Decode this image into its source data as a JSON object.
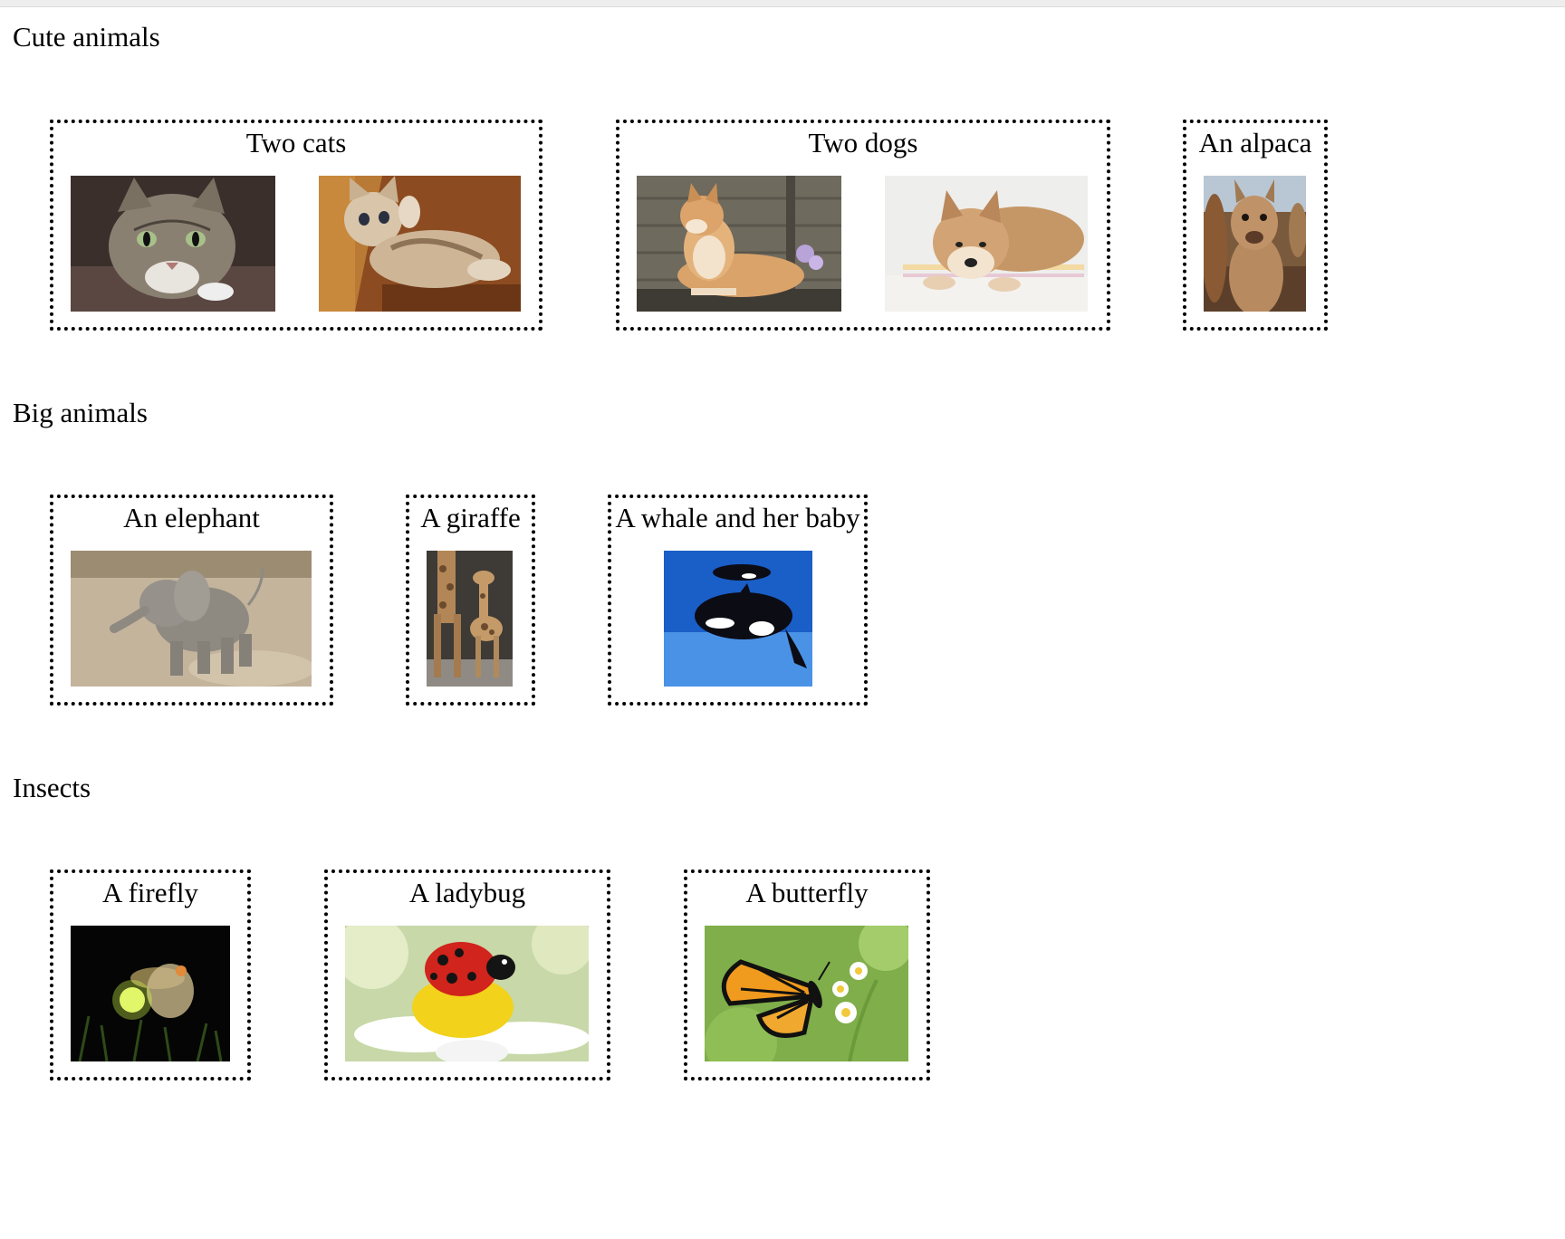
{
  "sections": [
    {
      "title": "Cute animals",
      "figures": [
        {
          "caption": "Two cats",
          "images": [
            {
              "icon": "tabby-cat"
            },
            {
              "icon": "kitten"
            }
          ]
        },
        {
          "caption": "Two dogs",
          "images": [
            {
              "icon": "shiba-lying-outdoors"
            },
            {
              "icon": "shiba-lying-indoors"
            }
          ]
        },
        {
          "caption": "An alpaca",
          "images": [
            {
              "icon": "alpaca"
            }
          ]
        }
      ]
    },
    {
      "title": "Big animals",
      "figures": [
        {
          "caption": "An elephant",
          "images": [
            {
              "icon": "baby-elephant"
            }
          ]
        },
        {
          "caption": "A giraffe",
          "images": [
            {
              "icon": "giraffes"
            }
          ]
        },
        {
          "caption": "A whale and her baby",
          "images": [
            {
              "icon": "orca-and-calf"
            }
          ]
        }
      ]
    },
    {
      "title": "Insects",
      "figures": [
        {
          "caption": "A firefly",
          "images": [
            {
              "icon": "firefly"
            }
          ]
        },
        {
          "caption": "A ladybug",
          "images": [
            {
              "icon": "ladybug-on-daisy"
            }
          ]
        },
        {
          "caption": "A butterfly",
          "images": [
            {
              "icon": "monarch-butterfly"
            }
          ]
        }
      ]
    }
  ]
}
